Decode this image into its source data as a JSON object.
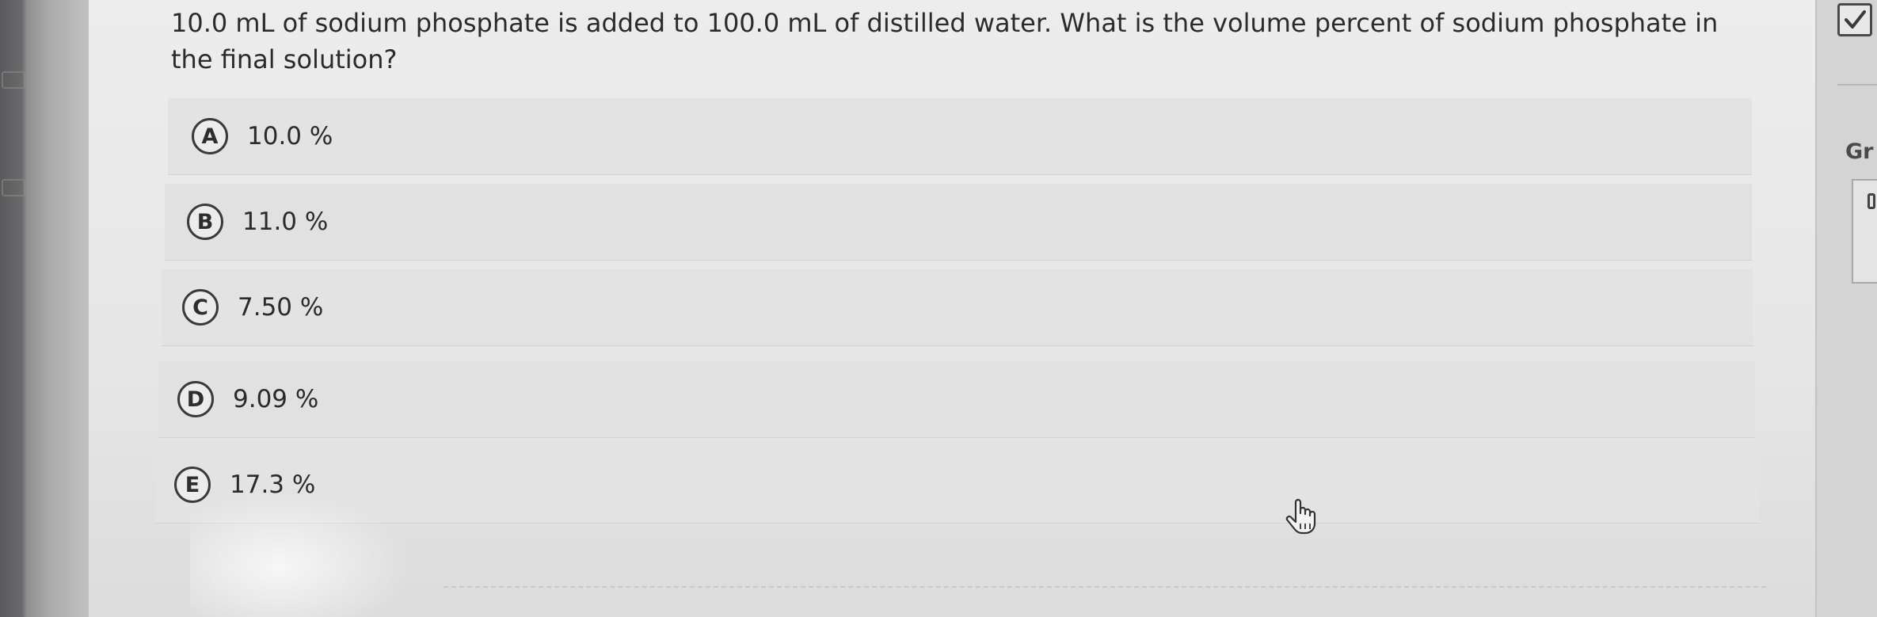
{
  "question": {
    "text": "10.0 mL of sodium phosphate is added to 100.0 mL of distilled water. What is the volume percent of sodium phosphate in the final solution?"
  },
  "options": [
    {
      "letter": "A",
      "text": "10.0 %"
    },
    {
      "letter": "B",
      "text": "11.0 %"
    },
    {
      "letter": "C",
      "text": "7.50 %"
    },
    {
      "letter": "D",
      "text": "9.09 %"
    },
    {
      "letter": "E",
      "text": "17.3 %"
    }
  ],
  "right_panel": {
    "label": "Gr"
  },
  "icons": {
    "checkbox": "checkmark-icon",
    "cursor": "hand-pointer-icon"
  },
  "colors": {
    "text": "#2b2b2b",
    "option_bg": "#e1e1e1",
    "circle_border": "#3a3a3a"
  }
}
